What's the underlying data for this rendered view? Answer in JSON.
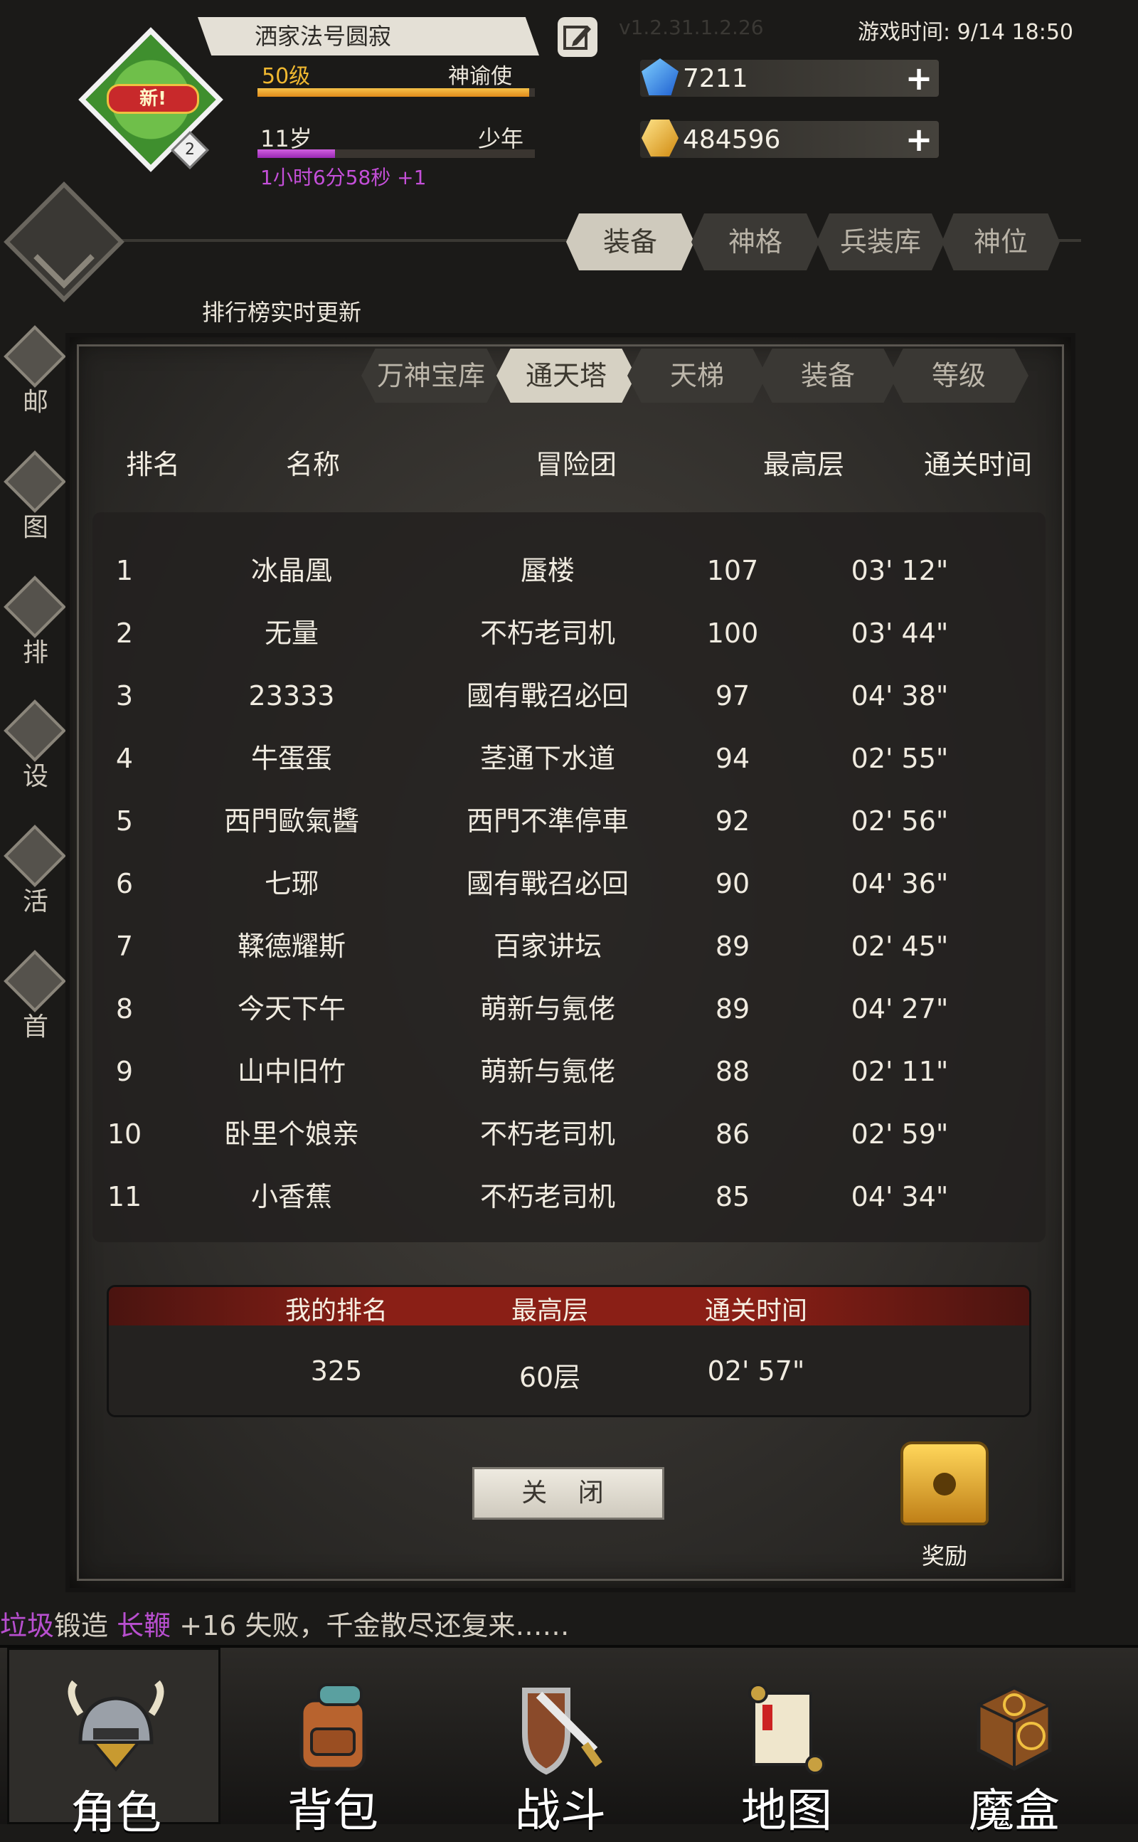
{
  "header": {
    "avatar_badge": "新!",
    "avatar_level": "2",
    "player_name": "洒家法号圆寂",
    "version": "v1.2.31.1.2.26",
    "game_time": "游戏时间: 9/14 18:50",
    "level": "50级",
    "title": "神谕使",
    "exp_fraction": 0.98,
    "age": "11岁",
    "stage": "少年",
    "age_fraction": 0.28,
    "age_timer": "1小时6分58秒 +1",
    "diamonds": "7211",
    "gold": "484596"
  },
  "main_tabs": [
    "装备",
    "神格",
    "兵装库",
    "神位"
  ],
  "rank_notice": "排行榜实时更新",
  "side_menu": [
    "邮",
    "图",
    "排",
    "设",
    "活",
    "首"
  ],
  "sub_tabs": [
    "万神宝库",
    "通天塔",
    "天梯",
    "装备",
    "等级"
  ],
  "table": {
    "headers": {
      "rank": "排名",
      "name": "名称",
      "team": "冒险团",
      "floor": "最高层",
      "time": "通关时间"
    },
    "rows": [
      {
        "rank": "1",
        "name": "冰晶凰",
        "team": "蜃楼",
        "floor": "107",
        "time": "03' 12\""
      },
      {
        "rank": "2",
        "name": "无量",
        "team": "不朽老司机",
        "floor": "100",
        "time": "03' 44\""
      },
      {
        "rank": "3",
        "name": "23333",
        "team": "國有戰召必回",
        "floor": "97",
        "time": "04' 38\""
      },
      {
        "rank": "4",
        "name": "牛蛋蛋",
        "team": "茎通下水道",
        "floor": "94",
        "time": "02' 55\""
      },
      {
        "rank": "5",
        "name": "西門歐氣醬",
        "team": "西門不準停車",
        "floor": "92",
        "time": "02' 56\""
      },
      {
        "rank": "6",
        "name": "七琊",
        "team": "國有戰召必回",
        "floor": "90",
        "time": "04' 36\""
      },
      {
        "rank": "7",
        "name": "鞣德耀斯",
        "team": "百家讲坛",
        "floor": "89",
        "time": "02' 45\""
      },
      {
        "rank": "8",
        "name": "今天下午",
        "team": "萌新与氪佬",
        "floor": "89",
        "time": "04' 27\""
      },
      {
        "rank": "9",
        "name": "山中旧竹",
        "team": "萌新与氪佬",
        "floor": "88",
        "time": "02' 11\""
      },
      {
        "rank": "10",
        "name": "卧里个娘亲",
        "team": "不朽老司机",
        "floor": "86",
        "time": "02' 59\""
      },
      {
        "rank": "11",
        "name": "小香蕉",
        "team": "不朽老司机",
        "floor": "85",
        "time": "04' 34\""
      }
    ]
  },
  "my_rank": {
    "headers": {
      "rank": "我的排名",
      "floor": "最高层",
      "time": "通关时间"
    },
    "rank": "325",
    "floor": "60层",
    "time": "02' 57\""
  },
  "close_label": "关 闭",
  "reward_label": "奖励",
  "log": {
    "junk": "垃圾",
    "forge": "锻造",
    "weapon": "长鞭",
    "rest": "+16 失败，千金散尽还复来……"
  },
  "bottom_nav": [
    {
      "label": "角色",
      "icon": "helmet-icon"
    },
    {
      "label": "背包",
      "icon": "backpack-icon"
    },
    {
      "label": "战斗",
      "icon": "sword-shield-icon"
    },
    {
      "label": "地图",
      "icon": "scroll-icon"
    },
    {
      "label": "魔盒",
      "icon": "magic-box-icon"
    }
  ],
  "colors": {
    "gold_text": "#f0b830",
    "purple_text": "#c44fd8",
    "my_rank_header": "#8a1f16"
  }
}
